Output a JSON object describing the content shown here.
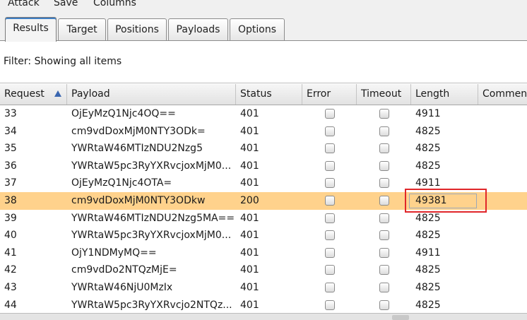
{
  "menu": [
    "Attack",
    "Save",
    "Columns"
  ],
  "tabs": [
    {
      "label": "Results",
      "active": true
    },
    {
      "label": "Target",
      "active": false
    },
    {
      "label": "Positions",
      "active": false
    },
    {
      "label": "Payloads",
      "active": false
    },
    {
      "label": "Options",
      "active": false
    }
  ],
  "filter": {
    "text": "Filter:  Showing all items"
  },
  "columns": [
    "Request",
    "Payload",
    "Status",
    "Error",
    "Timeout",
    "Length",
    "Comment"
  ],
  "sort_column": "Request",
  "rows": [
    {
      "request": "33",
      "payload": "OjEyMzQ1Njc4OQ==",
      "status": "401",
      "length": "4911",
      "error": false,
      "timeout": false,
      "selected": false
    },
    {
      "request": "34",
      "payload": "cm9vdDoxMjM0NTY3ODk=",
      "status": "401",
      "length": "4825",
      "error": false,
      "timeout": false,
      "selected": false
    },
    {
      "request": "35",
      "payload": "YWRtaW46MTIzNDU2Nzg5",
      "status": "401",
      "length": "4825",
      "error": false,
      "timeout": false,
      "selected": false
    },
    {
      "request": "36",
      "payload": "YWRtaW5pc3RyYXRvcjoxMjM0...",
      "status": "401",
      "length": "4825",
      "error": false,
      "timeout": false,
      "selected": false
    },
    {
      "request": "37",
      "payload": "OjEyMzQ1Njc4OTA=",
      "status": "401",
      "length": "4911",
      "error": false,
      "timeout": false,
      "selected": false
    },
    {
      "request": "38",
      "payload": "cm9vdDoxMjM0NTY3ODkw",
      "status": "200",
      "length": "49381",
      "error": false,
      "timeout": false,
      "selected": true
    },
    {
      "request": "39",
      "payload": "YWRtaW46MTIzNDU2Nzg5MA==",
      "status": "401",
      "length": "4825",
      "error": false,
      "timeout": false,
      "selected": false
    },
    {
      "request": "40",
      "payload": "YWRtaW5pc3RyYXRvcjoxMjM0...",
      "status": "401",
      "length": "4825",
      "error": false,
      "timeout": false,
      "selected": false
    },
    {
      "request": "41",
      "payload": "OjY1NDMyMQ==",
      "status": "401",
      "length": "4911",
      "error": false,
      "timeout": false,
      "selected": false
    },
    {
      "request": "42",
      "payload": "cm9vdDo2NTQzMjE=",
      "status": "401",
      "length": "4825",
      "error": false,
      "timeout": false,
      "selected": false
    },
    {
      "request": "43",
      "payload": "YWRtaW46NjU0MzIx",
      "status": "401",
      "length": "4825",
      "error": false,
      "timeout": false,
      "selected": false
    },
    {
      "request": "44",
      "payload": "YWRtaW5pc3RyYXRvcjo2NTQz...",
      "status": "401",
      "length": "4825",
      "error": false,
      "timeout": false,
      "selected": false
    }
  ],
  "colors": {
    "selected_row": "#ffd28c",
    "highlight_border": "#e0262a",
    "accent": "#3f7fc4"
  },
  "icons": {
    "sort": "sort-ascending-icon",
    "checkbox": "checkbox-unchecked-icon"
  }
}
